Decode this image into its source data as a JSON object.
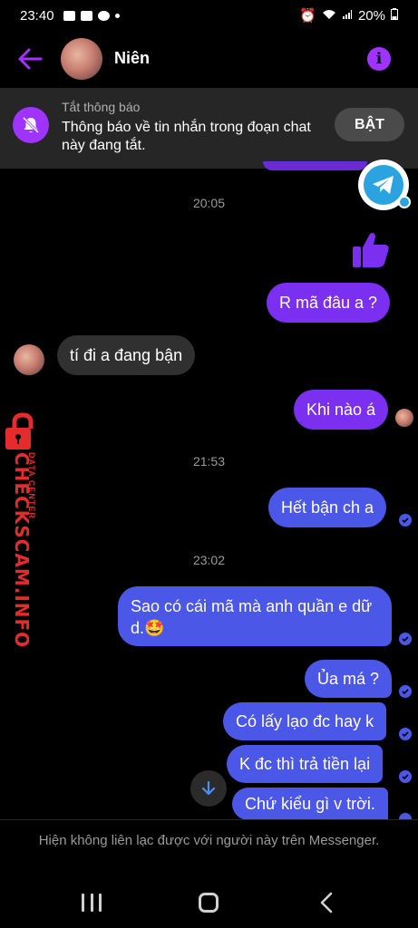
{
  "statusbar": {
    "time": "23:40",
    "battery": "20%"
  },
  "header": {
    "contact_name": "Niên"
  },
  "banner": {
    "title": "Tắt thông báo",
    "text": "Thông báo về tin nhắn trong đoạn chat này đang tắt.",
    "button": "BẬT"
  },
  "timestamps": [
    "20:05",
    "21:53",
    "23:02"
  ],
  "messages": [
    {
      "text": "R mã đâu a ?"
    },
    {
      "text": "tí đi a đang bận"
    },
    {
      "text": "Khi nào á"
    },
    {
      "text": "Hết bận ch a"
    },
    {
      "text": "Sao có cái mã mà anh quần e dữ d.🤩"
    },
    {
      "text": "Ủa má ?"
    },
    {
      "text": "Có lấy lạo đc hay k"
    },
    {
      "text": "K đc thì trả tiền lại"
    },
    {
      "text": "Chứ kiểu gì v trời."
    }
  ],
  "watermark": {
    "brand": "CHECKSCAM.INFO",
    "subtitle": "DATA CENTER"
  },
  "footer": {
    "text": "Hiện không liên lạc được với người này trên Messenger."
  },
  "colors": {
    "accent": "#a033ff",
    "bubble_purple": "#7b2ff0",
    "bubble_blue": "#4b57e6",
    "incoming": "#303030"
  }
}
